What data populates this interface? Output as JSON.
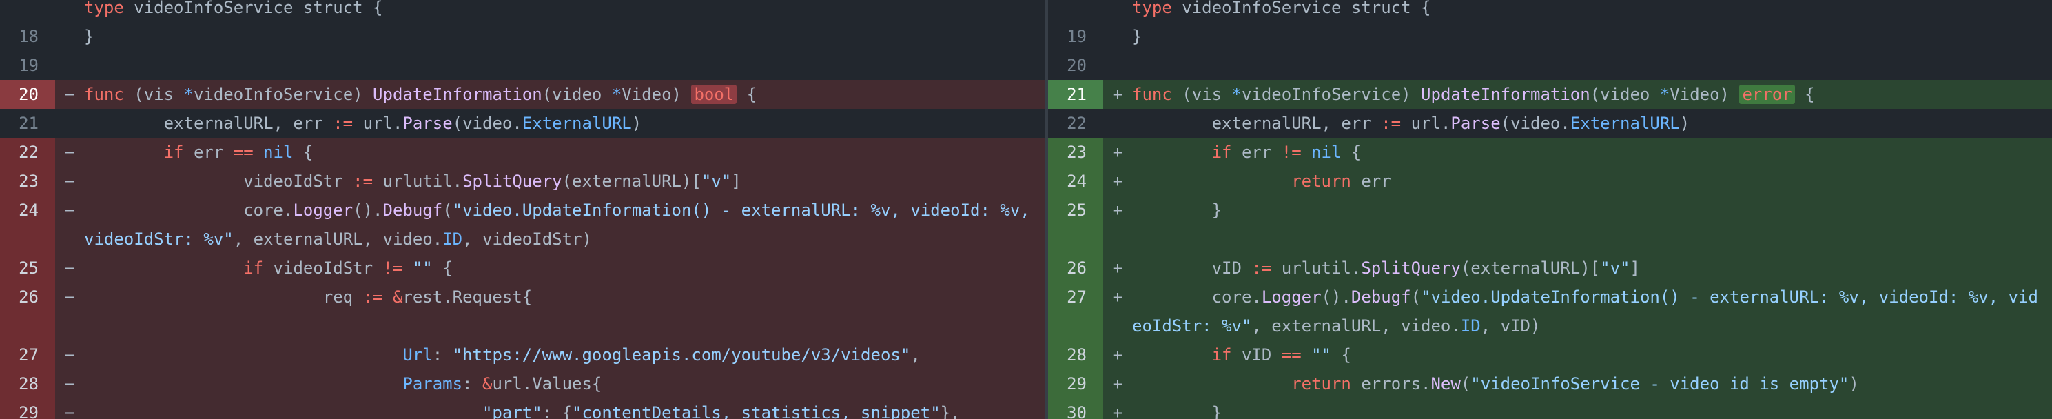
{
  "left": {
    "rows": [
      {
        "kind": "ctx",
        "num": "",
        "marker": "",
        "tokens": [
          [
            "kw",
            "type"
          ],
          [
            "plain",
            " videoInfoService struct {"
          ]
        ]
      },
      {
        "kind": "ctx",
        "num": "18",
        "marker": "",
        "tokens": [
          [
            "plain",
            "}"
          ]
        ]
      },
      {
        "kind": "ctx",
        "num": "19",
        "marker": "",
        "tokens": []
      },
      {
        "kind": "del",
        "hl": true,
        "num": "20",
        "marker": "−",
        "tokens": [
          [
            "kw",
            "func"
          ],
          [
            "plain",
            " (vis "
          ],
          [
            "ptr",
            "*"
          ],
          [
            "plain",
            "videoInfoService) "
          ],
          [
            "fn",
            "UpdateInformation"
          ],
          [
            "plain",
            "(video "
          ],
          [
            "ptr",
            "*"
          ],
          [
            "plain",
            "Video) "
          ],
          [
            "typehl-del",
            "bool"
          ],
          [
            "plain",
            " {"
          ]
        ]
      },
      {
        "kind": "ctx",
        "num": "21",
        "marker": "",
        "tokens": [
          [
            "plain",
            "        externalURL, err "
          ],
          [
            "op",
            ":="
          ],
          [
            "plain",
            " url."
          ],
          [
            "fn",
            "Parse"
          ],
          [
            "plain",
            "(video."
          ],
          [
            "prop",
            "ExternalURL"
          ],
          [
            "plain",
            ")"
          ]
        ]
      },
      {
        "kind": "del",
        "num": "22",
        "marker": "−",
        "tokens": [
          [
            "plain",
            "        "
          ],
          [
            "kw",
            "if"
          ],
          [
            "plain",
            " err "
          ],
          [
            "op",
            "=="
          ],
          [
            "plain",
            " "
          ],
          [
            "prop",
            "nil"
          ],
          [
            "plain",
            " {"
          ]
        ]
      },
      {
        "kind": "del",
        "num": "23",
        "marker": "−",
        "tokens": [
          [
            "plain",
            "                videoIdStr "
          ],
          [
            "op",
            ":="
          ],
          [
            "plain",
            " urlutil."
          ],
          [
            "fn",
            "SplitQuery"
          ],
          [
            "plain",
            "(externalURL)["
          ],
          [
            "str",
            "\"v\""
          ],
          [
            "plain",
            "]"
          ]
        ]
      },
      {
        "kind": "del",
        "num": "24",
        "marker": "−",
        "tokens": [
          [
            "plain",
            "                core."
          ],
          [
            "fn",
            "Logger"
          ],
          [
            "plain",
            "()."
          ],
          [
            "fn",
            "Debugf"
          ],
          [
            "plain",
            "("
          ],
          [
            "str",
            "\"video.UpdateInformation() - externalURL: %v, videoId: %v, videoIdStr: %v\""
          ],
          [
            "plain",
            ", externalURL, video."
          ],
          [
            "prop",
            "ID"
          ],
          [
            "plain",
            ", videoIdStr)"
          ]
        ]
      },
      {
        "kind": "del",
        "num": "25",
        "marker": "−",
        "tokens": [
          [
            "plain",
            "                "
          ],
          [
            "kw",
            "if"
          ],
          [
            "plain",
            " videoIdStr "
          ],
          [
            "op",
            "!="
          ],
          [
            "plain",
            " "
          ],
          [
            "str",
            "\"\""
          ],
          [
            "plain",
            " {"
          ]
        ]
      },
      {
        "kind": "del",
        "num": "26",
        "marker": "−",
        "tokens": [
          [
            "plain",
            "                        req "
          ],
          [
            "op",
            ":="
          ],
          [
            "plain",
            " "
          ],
          [
            "op",
            "&"
          ],
          [
            "plain",
            "rest.Request{"
          ]
        ]
      },
      {
        "kind": "del",
        "num": "",
        "marker": "",
        "tokens": []
      },
      {
        "kind": "del",
        "num": "27",
        "marker": "−",
        "tokens": [
          [
            "plain",
            "                                "
          ],
          [
            "prop",
            "Url"
          ],
          [
            "plain",
            ": "
          ],
          [
            "str",
            "\"https://www.googleapis.com/youtube/v3/videos\""
          ],
          [
            "plain",
            ","
          ]
        ]
      },
      {
        "kind": "del",
        "num": "28",
        "marker": "−",
        "tokens": [
          [
            "plain",
            "                                "
          ],
          [
            "prop",
            "Params"
          ],
          [
            "plain",
            ": "
          ],
          [
            "op",
            "&"
          ],
          [
            "plain",
            "url.Values{"
          ]
        ]
      },
      {
        "kind": "del",
        "num": "29",
        "marker": "−",
        "tokens": [
          [
            "plain",
            "                                        "
          ],
          [
            "str",
            "\"part\""
          ],
          [
            "plain",
            ": {"
          ],
          [
            "str",
            "\"contentDetails, statistics, snippet\""
          ],
          [
            "plain",
            "},"
          ]
        ]
      }
    ]
  },
  "right": {
    "rows": [
      {
        "kind": "ctx",
        "num": "",
        "marker": "",
        "tokens": [
          [
            "kw",
            "type"
          ],
          [
            "plain",
            " videoInfoService struct {"
          ]
        ]
      },
      {
        "kind": "ctx",
        "num": "19",
        "marker": "",
        "tokens": [
          [
            "plain",
            "}"
          ]
        ]
      },
      {
        "kind": "ctx",
        "num": "20",
        "marker": "",
        "tokens": []
      },
      {
        "kind": "add",
        "hl": true,
        "num": "21",
        "marker": "+",
        "tokens": [
          [
            "kw",
            "func"
          ],
          [
            "plain",
            " (vis "
          ],
          [
            "ptr",
            "*"
          ],
          [
            "plain",
            "videoInfoService) "
          ],
          [
            "fn",
            "UpdateInformation"
          ],
          [
            "plain",
            "(video "
          ],
          [
            "ptr",
            "*"
          ],
          [
            "plain",
            "Video) "
          ],
          [
            "typehl-add",
            "error"
          ],
          [
            "plain",
            " {"
          ]
        ]
      },
      {
        "kind": "ctx",
        "num": "22",
        "marker": "",
        "tokens": [
          [
            "plain",
            "        externalURL, err "
          ],
          [
            "op",
            ":="
          ],
          [
            "plain",
            " url."
          ],
          [
            "fn",
            "Parse"
          ],
          [
            "plain",
            "(video."
          ],
          [
            "prop",
            "ExternalURL"
          ],
          [
            "plain",
            ")"
          ]
        ]
      },
      {
        "kind": "add",
        "num": "23",
        "marker": "+",
        "tokens": [
          [
            "plain",
            "        "
          ],
          [
            "kw",
            "if"
          ],
          [
            "plain",
            " err "
          ],
          [
            "op",
            "!="
          ],
          [
            "plain",
            " "
          ],
          [
            "prop",
            "nil"
          ],
          [
            "plain",
            " {"
          ]
        ]
      },
      {
        "kind": "add",
        "num": "24",
        "marker": "+",
        "tokens": [
          [
            "plain",
            "                "
          ],
          [
            "kw",
            "return"
          ],
          [
            "plain",
            " err"
          ]
        ]
      },
      {
        "kind": "add",
        "num": "25",
        "marker": "+",
        "tokens": [
          [
            "plain",
            "        }"
          ]
        ]
      },
      {
        "kind": "add",
        "num": "",
        "marker": "",
        "tokens": []
      },
      {
        "kind": "add",
        "num": "26",
        "marker": "+",
        "tokens": [
          [
            "plain",
            "        vID "
          ],
          [
            "op",
            ":="
          ],
          [
            "plain",
            " urlutil."
          ],
          [
            "fn",
            "SplitQuery"
          ],
          [
            "plain",
            "(externalURL)["
          ],
          [
            "str",
            "\"v\""
          ],
          [
            "plain",
            "]"
          ]
        ]
      },
      {
        "kind": "add",
        "num": "27",
        "marker": "+",
        "tokens": [
          [
            "plain",
            "        core."
          ],
          [
            "fn",
            "Logger"
          ],
          [
            "plain",
            "()."
          ],
          [
            "fn",
            "Debugf"
          ],
          [
            "plain",
            "("
          ],
          [
            "str",
            "\"video.UpdateInformation() - externalURL: %v, videoId: %v, videoIdStr: %v\""
          ],
          [
            "plain",
            ", externalURL, video."
          ],
          [
            "prop",
            "ID"
          ],
          [
            "plain",
            ", vID)"
          ]
        ]
      },
      {
        "kind": "add",
        "num": "28",
        "marker": "+",
        "tokens": [
          [
            "plain",
            "        "
          ],
          [
            "kw",
            "if"
          ],
          [
            "plain",
            " vID "
          ],
          [
            "op",
            "=="
          ],
          [
            "plain",
            " "
          ],
          [
            "str",
            "\"\""
          ],
          [
            "plain",
            " {"
          ]
        ]
      },
      {
        "kind": "add",
        "num": "29",
        "marker": "+",
        "tokens": [
          [
            "plain",
            "                "
          ],
          [
            "kw",
            "return"
          ],
          [
            "plain",
            " errors."
          ],
          [
            "fn",
            "New"
          ],
          [
            "plain",
            "("
          ],
          [
            "str",
            "\"videoInfoService - video id is empty\""
          ],
          [
            "plain",
            ")"
          ]
        ]
      },
      {
        "kind": "add",
        "num": "30",
        "marker": "+",
        "tokens": [
          [
            "plain",
            "        }"
          ]
        ]
      }
    ]
  }
}
